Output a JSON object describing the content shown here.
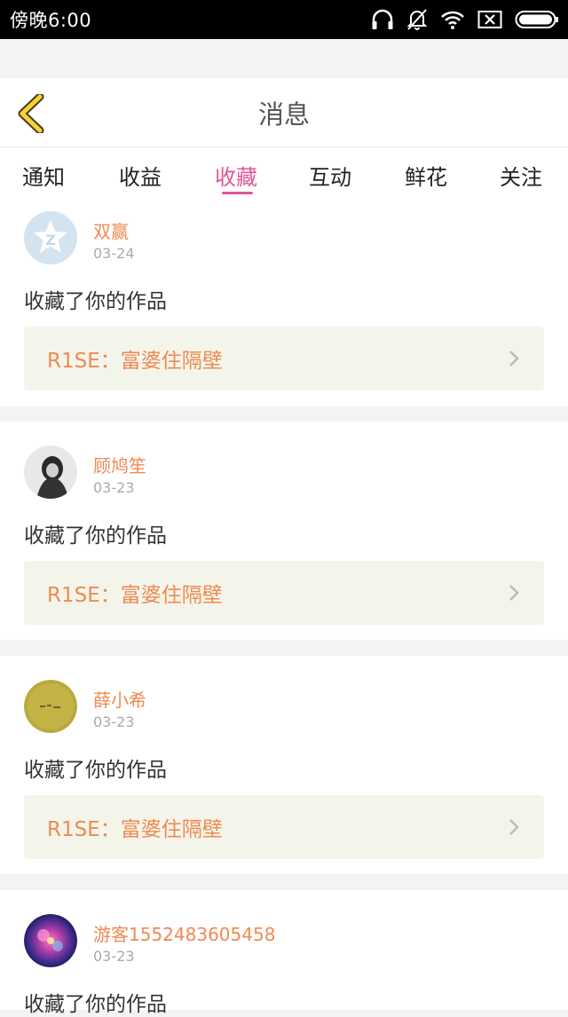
{
  "status_bar": {
    "time": "傍晚6:00",
    "icons": [
      "headphones-icon",
      "mute-bell-icon",
      "wifi-icon",
      "sim-off-icon",
      "battery-icon"
    ]
  },
  "header": {
    "title": "消息",
    "back_icon": "chevron-left-icon"
  },
  "tabs": [
    {
      "label": "通知",
      "active": false
    },
    {
      "label": "收益",
      "active": false
    },
    {
      "label": "收藏",
      "active": true
    },
    {
      "label": "互动",
      "active": false
    },
    {
      "label": "鲜花",
      "active": false
    },
    {
      "label": "关注",
      "active": false
    }
  ],
  "colors": {
    "accent": "#e05596",
    "name": "#ee8a52",
    "work_bg": "#f4f5ea"
  },
  "messages": [
    {
      "name": "双赢",
      "date": "03-24",
      "action": "收藏了你的作品",
      "work": "R1SE：富婆住隔壁",
      "avatar": "qzone-logo-avatar"
    },
    {
      "name": "顾鸠笙",
      "date": "03-23",
      "action": "收藏了你的作品",
      "work": "R1SE：富婆住隔壁",
      "avatar": "photo-avatar"
    },
    {
      "name": "薛小希",
      "date": "03-23",
      "action": "收藏了你的作品",
      "work": "R1SE：富婆住隔壁",
      "avatar": "yellow-note-avatar"
    },
    {
      "name": "游客1552483605458",
      "date": "03-23",
      "action": "收藏了你的作品",
      "work": "",
      "avatar": "galaxy-avatar"
    }
  ]
}
